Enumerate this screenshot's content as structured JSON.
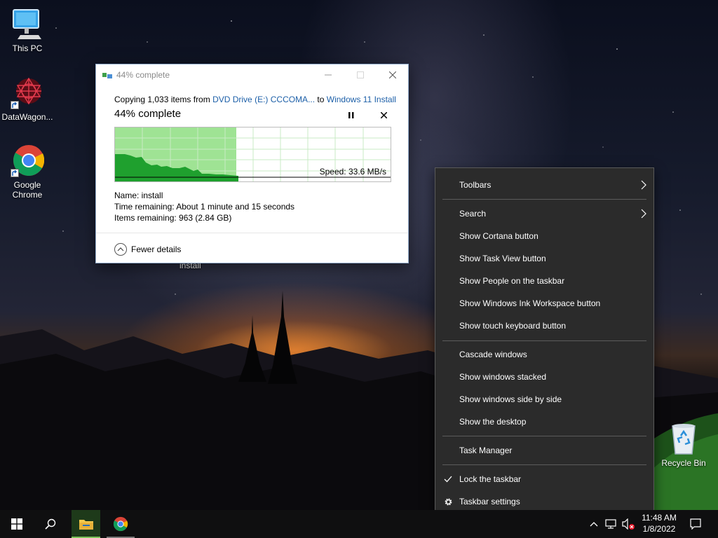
{
  "desktop": {
    "icons": [
      {
        "label": "This PC"
      },
      {
        "label": "DataWagon..."
      },
      {
        "label": "Google Chrome"
      },
      {
        "label": "Recycle Bin"
      }
    ],
    "background_item_label": "install"
  },
  "copy_dialog": {
    "title": "44% complete",
    "copying_prefix": "Copying 1,033 items from ",
    "source": "DVD Drive (E:) CCCOMA...",
    "to_word": " to ",
    "destination": "Windows 11 Install",
    "percent_label": "44% complete",
    "progress_fraction": 0.44,
    "speed_label": "Speed: 33.6 MB/s",
    "name_line": "Name:  install",
    "time_line": "Time remaining:  About 1 minute and 15 seconds",
    "items_line": "Items remaining:  963 (2.84 GB)",
    "fewer_details": "Fewer details",
    "colors": {
      "progress_fill": "#9fe394",
      "graph_fill": "#1fa02e",
      "grid": "#c9ebc4"
    }
  },
  "context_menu": {
    "items": [
      {
        "label": "Toolbars",
        "submenu": true
      },
      {
        "label": "Search",
        "submenu": true
      },
      {
        "label": "Show Cortana button"
      },
      {
        "label": "Show Task View button"
      },
      {
        "label": "Show People on the taskbar"
      },
      {
        "label": "Show Windows Ink Workspace button"
      },
      {
        "label": "Show touch keyboard button"
      },
      {
        "label": "Cascade windows"
      },
      {
        "label": "Show windows stacked"
      },
      {
        "label": "Show windows side by side"
      },
      {
        "label": "Show the desktop"
      },
      {
        "label": "Task Manager"
      },
      {
        "label": "Lock the taskbar",
        "checked": true
      },
      {
        "label": "Taskbar settings",
        "icon": "gear-icon"
      }
    ]
  },
  "taskbar": {
    "time": "11:48 AM",
    "date": "1/8/2022",
    "apps": [
      "start-icon",
      "search-icon",
      "file-explorer-icon",
      "chrome-icon"
    ],
    "tray": [
      "chevron-up-icon",
      "network-icon",
      "volume-muted-icon",
      "notification-icon"
    ]
  }
}
